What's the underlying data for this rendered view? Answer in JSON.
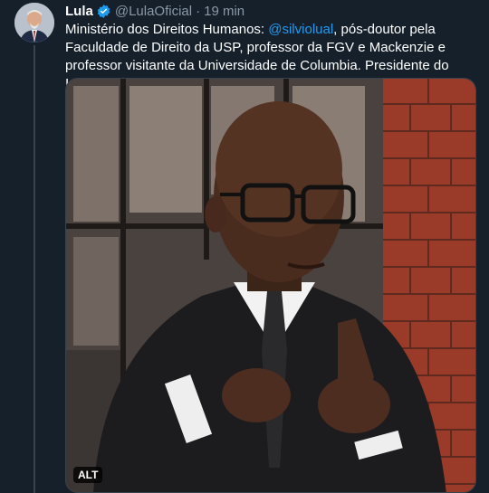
{
  "tweet": {
    "author_name": "Lula",
    "handle": "@LulaOficial",
    "separator": "·",
    "time": "19 min",
    "text_before": "Ministério dos Direitos Humanos: ",
    "mention": "@silviolual",
    "text_after": ", pós-doutor pela Faculdade de Direito da USP, professor da FGV e Mackenzie e professor visitante da Universidade de Columbia. Presidente do Instituto Luiz Gama.",
    "media_alt_badge": "ALT"
  },
  "colors": {
    "background": "#15202b",
    "text": "#ffffff",
    "secondary_text": "#8b98a5",
    "link": "#1d9bf0",
    "verified": "#1d9bf0"
  },
  "icons": [
    "verified-badge-icon"
  ]
}
